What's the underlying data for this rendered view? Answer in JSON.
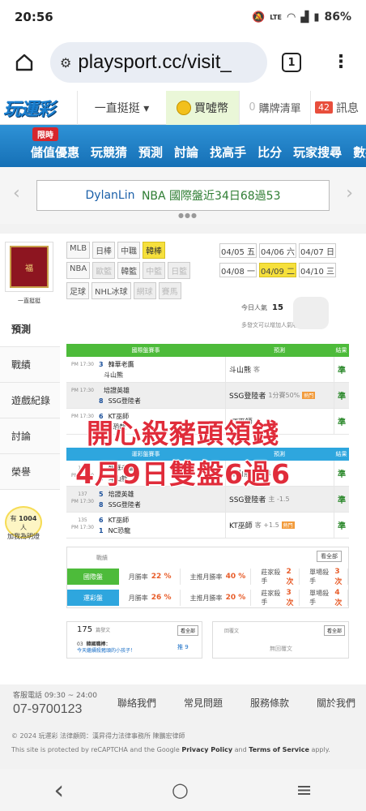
{
  "status_bar": {
    "time": "20:56",
    "battery": "86%",
    "icons": [
      "mute-icon",
      "lte-icon",
      "wifi-icon",
      "signal-icon",
      "battery-icon"
    ]
  },
  "browser": {
    "url": "playsport.cc/visit_",
    "tab_count": "1"
  },
  "topnav": {
    "logo": "玩運彩",
    "category": "一直挺挺 ▾",
    "buy_coins": "買噓幣",
    "cart_count": "0",
    "cart_label": "購牌清單",
    "msg_count": "42",
    "msg_label": "訊息"
  },
  "bluenav": {
    "limited": "限時",
    "items": [
      "儲值優惠",
      "玩競猜",
      "預測",
      "討論",
      "找高手",
      "比分",
      "玩家搜尋",
      "數據"
    ]
  },
  "ticker": {
    "name": "DylanLin",
    "text": "NBA 國際盤近34日68過53"
  },
  "profile": {
    "name": "一直挺挺"
  },
  "sidebar": {
    "tabs": [
      "預測",
      "戰績",
      "遊戲紀錄",
      "討論",
      "榮譽"
    ],
    "bulb_line1": "有",
    "bulb_count": "1004",
    "bulb_unit": "人",
    "bulb_line2": "加我為明燈"
  },
  "leagues": {
    "row1": [
      {
        "t": "MLB",
        "s": ""
      },
      {
        "t": "日棒",
        "s": ""
      },
      {
        "t": "中職",
        "s": ""
      },
      {
        "t": "韓棒",
        "s": "on"
      }
    ],
    "row2": [
      {
        "t": "NBA",
        "s": ""
      },
      {
        "t": "歐籃",
        "s": "dis"
      },
      {
        "t": "韓籃",
        "s": ""
      },
      {
        "t": "中籃",
        "s": "dis"
      },
      {
        "t": "日籃",
        "s": "dis"
      }
    ],
    "row3": [
      {
        "t": "足球",
        "s": ""
      },
      {
        "t": "NHL冰球",
        "s": ""
      },
      {
        "t": "網球",
        "s": "dis"
      },
      {
        "t": "賽馬",
        "s": "dis"
      }
    ]
  },
  "dates": {
    "row1": [
      {
        "t": "04/05 五",
        "s": ""
      },
      {
        "t": "04/06 六",
        "s": ""
      },
      {
        "t": "04/07 日",
        "s": ""
      }
    ],
    "row2": [
      {
        "t": "04/08 一",
        "s": ""
      },
      {
        "t": "04/09 二",
        "s": "on"
      },
      {
        "t": "04/10 三",
        "s": ""
      }
    ]
  },
  "today": {
    "label": "今日人氣",
    "value": "15",
    "hint": "多發文可以增加人氣喔～"
  },
  "intl_table": {
    "header": [
      "國際盤賽事",
      "預測",
      "結果"
    ],
    "rows": [
      {
        "no": "",
        "time": "PM 17:30",
        "s1": "3",
        "t1": "韓華老鷹",
        "s2": "",
        "t2": "斗山熊",
        "pick": "斗山熊",
        "note": "客",
        "hl": "",
        "res": "準"
      },
      {
        "no": "",
        "time": "PM 17:30",
        "s1": "",
        "t1": "培證英雄",
        "s2": "8",
        "t2": "SSG登陸者",
        "pick": "SSG登陸者",
        "note": "1分賽50%",
        "hl": "熱門",
        "res": "準"
      },
      {
        "no": "",
        "time": "PM 17:30",
        "s1": "6",
        "t1": "KT巫師",
        "s2": "",
        "t2": "NC恐龍",
        "pick": "KT巫師",
        "note": "",
        "hl": "",
        "res": "準"
      }
    ]
  },
  "tw_table": {
    "header": [
      "運彩盤賽事",
      "預測",
      "結果"
    ],
    "rows": [
      {
        "no": "139",
        "time": "PM 17:30",
        "s1": "3",
        "t1": "韓華老鷹",
        "s2": "5",
        "t2": "斗山熊",
        "pick": "斗山熊",
        "note": "主 +1.5",
        "hl": "",
        "res": "準"
      },
      {
        "no": "137",
        "time": "PM 17:30",
        "s1": "5",
        "t1": "培證英雄",
        "s2": "8",
        "t2": "SSG登陸者",
        "pick": "SSG登陸者",
        "note": "主 -1.5",
        "hl": "",
        "res": "準"
      },
      {
        "no": "135",
        "time": "PM 17:30",
        "s1": "6",
        "t1": "KT巫師",
        "s2": "1",
        "t2": "NC恐龍",
        "pick": "KT巫師",
        "note": "客 +1.5",
        "hl": "熱門",
        "res": "準"
      }
    ]
  },
  "record": {
    "title": "戰績",
    "view_all": "看全部",
    "rows": [
      {
        "label": "國際盤",
        "win": "月勝率",
        "win_v": "22 %",
        "main": "主推月勝率",
        "main_v": "40 %",
        "hunter": "莊家殺手",
        "hunter_v": "2 次",
        "single": "單場殺手",
        "single_v": "3 次"
      },
      {
        "label": "運彩盤",
        "win": "月勝率",
        "win_v": "26 %",
        "main": "主推月勝率",
        "main_v": "20 %",
        "hunter": "莊家殺手",
        "hunter_v": "3 次",
        "single": "單場殺手",
        "single_v": "4 次"
      }
    ]
  },
  "posts": {
    "count": "175",
    "unit": "篇發文",
    "view_all": "看全部",
    "item_no": "03",
    "item_title": "韓國職棒：",
    "item_sub": "今天繼續殺豬頭的小孩子！",
    "item_tag": "推 9"
  },
  "replies": {
    "title": "回覆文",
    "view_all": "看全部",
    "empty": "無回覆文"
  },
  "overlay": {
    "line1": "4月9日雙盤6過6",
    "line2": "開心殺豬頭領錢"
  },
  "footer": {
    "svc_label": "客服電話 09:30 ~ 24:00",
    "phone": "07-9700123",
    "links": [
      "聯絡我們",
      "常見問題",
      "服務條款",
      "關於我們"
    ],
    "copyright": "© 2024 玩運彩 法律顧問：漢昇得力法律事務所 陳鵬宏律師",
    "recaptcha_a": "This site is protected by reCAPTCHA and the Google ",
    "privacy": "Privacy Policy",
    "and": " and ",
    "terms": "Terms of Service",
    "apply": " apply."
  },
  "android_nav": {
    "back": "‹",
    "home": "○",
    "recents": "≡"
  }
}
